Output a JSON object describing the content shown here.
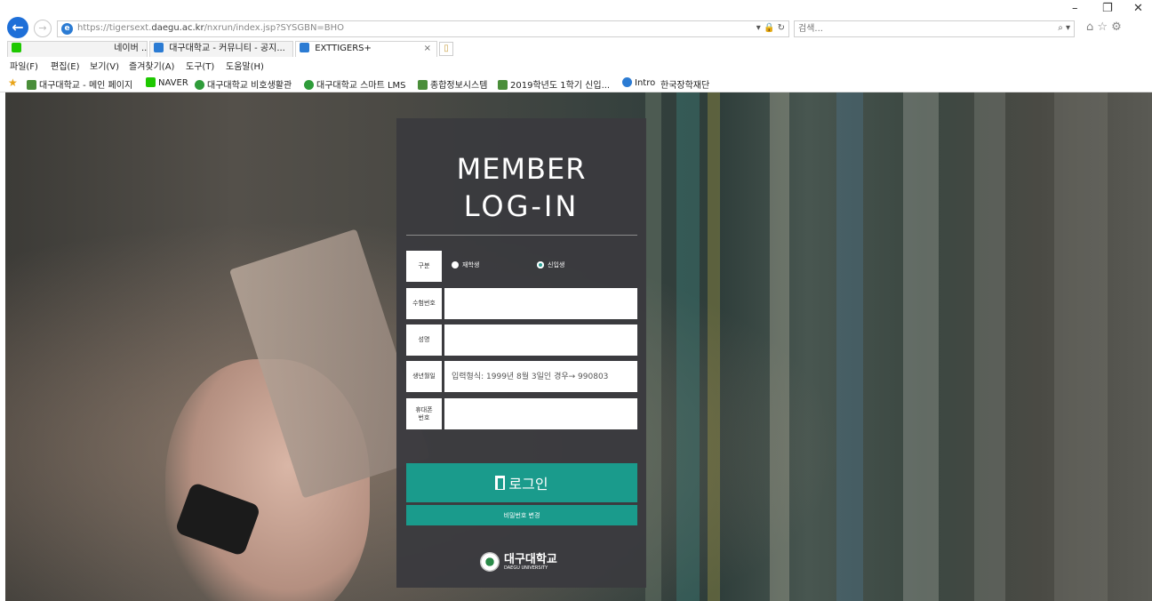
{
  "browser": {
    "url_prefix": "https://tigersext.",
    "url_domain": "daegu.ac.kr",
    "url_path": "/nxrun/index.jsp?SYSGBN=BHO",
    "url_tools": "▾ 🔒 ↻",
    "search_placeholder": "검색...",
    "window": {
      "minimize": "–",
      "restore": "❐",
      "close": "✕"
    },
    "right_icons": "⌂ ☆ ⚙",
    "tabs": [
      {
        "label": "네이버 ...",
        "active": false
      },
      {
        "label": "대구대학교 - 커뮤니티 - 공지...",
        "active": false
      },
      {
        "label": "EXTTIGERS+",
        "active": true
      }
    ],
    "menu": [
      "파일(F)",
      "편집(E)",
      "보기(V)",
      "즐겨찾기(A)",
      "도구(T)",
      "도움말(H)"
    ],
    "favorites": [
      "대구대학교 - 메인 페이지",
      "NAVER",
      "대구대학교 비호생활관",
      "대구대학교 스마트 LMS",
      "종합정보시스템",
      "2019학년도 1학기 신입...",
      "Intro",
      "한국장학재단"
    ]
  },
  "login": {
    "title_line1": "MEMBER",
    "title_line2": "LOG-IN",
    "type_label": "구분",
    "radio_enrolled": "재학생",
    "radio_freshman": "신입생",
    "exam_no_label": "수험번호",
    "name_label": "성명",
    "birth_label": "생년월일",
    "birth_placeholder": "입력형식: 1999년 8월 3일인 경우→ 990803",
    "phone_label_1": "휴대폰",
    "phone_label_2": "번호",
    "login_button": "로그인",
    "change_password_button": "비밀번호 변경",
    "logo_name": "대구대학교",
    "logo_sub": "DAEGU UNIVERSITY"
  }
}
